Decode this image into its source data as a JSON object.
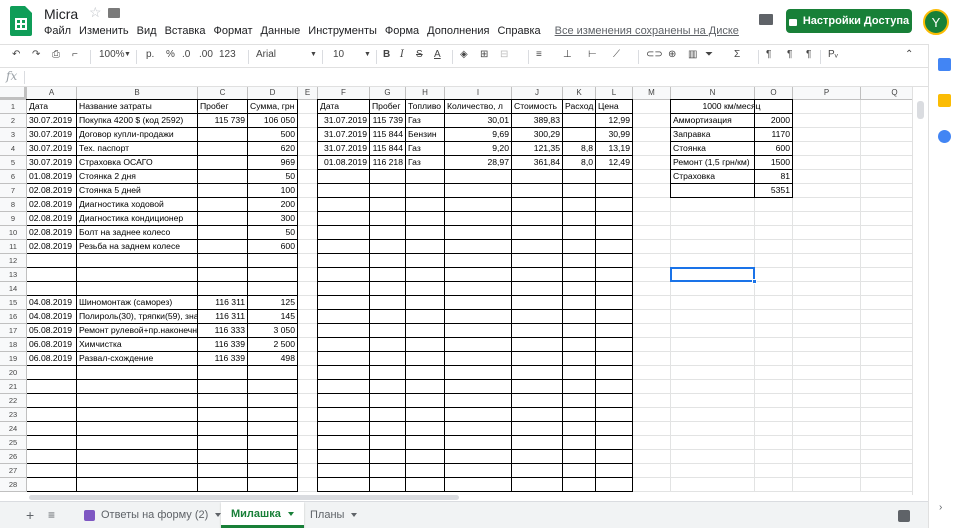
{
  "doc": {
    "title": "Micra",
    "star_icon": "star-icon",
    "folder_icon": "folder-icon"
  },
  "menu": [
    "Файл",
    "Изменить",
    "Вид",
    "Вставка",
    "Формат",
    "Данные",
    "Инструменты",
    "Форма",
    "Дополнения",
    "Справка"
  ],
  "saved_status": "Все изменения сохранены на Диске",
  "share_label": "Настройки Доступа",
  "avatar_letter": "Y",
  "toolbar": {
    "zoom": "100%",
    "currency": "р.",
    "percent": "%",
    "dec_dec": ".0",
    "inc_dec": ".00",
    "format_more": "123",
    "font": "Arial",
    "font_size": "10"
  },
  "columns": [
    {
      "name": "A",
      "w": 50
    },
    {
      "name": "B",
      "w": 121
    },
    {
      "name": "C",
      "w": 50
    },
    {
      "name": "D",
      "w": 50
    },
    {
      "name": "E",
      "w": 20
    },
    {
      "name": "F",
      "w": 52
    },
    {
      "name": "G",
      "w": 36
    },
    {
      "name": "H",
      "w": 39
    },
    {
      "name": "I",
      "w": 67
    },
    {
      "name": "J",
      "w": 51
    },
    {
      "name": "K",
      "w": 33
    },
    {
      "name": "L",
      "w": 37
    },
    {
      "name": "M",
      "w": 38
    },
    {
      "name": "N",
      "w": 84
    },
    {
      "name": "O",
      "w": 38
    },
    {
      "name": "P",
      "w": 68
    },
    {
      "name": "Q",
      "w": 68
    }
  ],
  "row_count": 28,
  "cells": [
    {
      "r": 1,
      "c": "A",
      "v": "Дата"
    },
    {
      "r": 1,
      "c": "B",
      "v": "Название затраты"
    },
    {
      "r": 1,
      "c": "C",
      "v": "Пробег"
    },
    {
      "r": 1,
      "c": "D",
      "v": "Сумма, грн"
    },
    {
      "r": 2,
      "c": "A",
      "v": "30.07.2019"
    },
    {
      "r": 2,
      "c": "B",
      "v": "Покупка 4200 $ (код 2592)"
    },
    {
      "r": 2,
      "c": "C",
      "v": "115 739",
      "a": "r"
    },
    {
      "r": 2,
      "c": "D",
      "v": "106 050",
      "a": "r"
    },
    {
      "r": 3,
      "c": "A",
      "v": "30.07.2019"
    },
    {
      "r": 3,
      "c": "B",
      "v": "Договор купли-продажи"
    },
    {
      "r": 3,
      "c": "D",
      "v": "500",
      "a": "r"
    },
    {
      "r": 4,
      "c": "A",
      "v": "30.07.2019"
    },
    {
      "r": 4,
      "c": "B",
      "v": "Тех. паспорт"
    },
    {
      "r": 4,
      "c": "D",
      "v": "620",
      "a": "r"
    },
    {
      "r": 5,
      "c": "A",
      "v": "30.07.2019"
    },
    {
      "r": 5,
      "c": "B",
      "v": "Страховка ОСАГО"
    },
    {
      "r": 5,
      "c": "D",
      "v": "969",
      "a": "r"
    },
    {
      "r": 6,
      "c": "A",
      "v": "01.08.2019"
    },
    {
      "r": 6,
      "c": "B",
      "v": "Стоянка 2 дня"
    },
    {
      "r": 6,
      "c": "D",
      "v": "50",
      "a": "r"
    },
    {
      "r": 7,
      "c": "A",
      "v": "02.08.2019"
    },
    {
      "r": 7,
      "c": "B",
      "v": "Стоянка 5 дней"
    },
    {
      "r": 7,
      "c": "D",
      "v": "100",
      "a": "r"
    },
    {
      "r": 8,
      "c": "A",
      "v": "02.08.2019"
    },
    {
      "r": 8,
      "c": "B",
      "v": "Диагностика ходовой"
    },
    {
      "r": 8,
      "c": "D",
      "v": "200",
      "a": "r"
    },
    {
      "r": 9,
      "c": "A",
      "v": "02.08.2019"
    },
    {
      "r": 9,
      "c": "B",
      "v": "Диагностика кондиционер"
    },
    {
      "r": 9,
      "c": "D",
      "v": "300",
      "a": "r"
    },
    {
      "r": 10,
      "c": "A",
      "v": "02.08.2019"
    },
    {
      "r": 10,
      "c": "B",
      "v": "Болт на заднее колесо"
    },
    {
      "r": 10,
      "c": "D",
      "v": "50",
      "a": "r"
    },
    {
      "r": 11,
      "c": "A",
      "v": "02.08.2019"
    },
    {
      "r": 11,
      "c": "B",
      "v": "Резьба на заднем колесе"
    },
    {
      "r": 11,
      "c": "D",
      "v": "600",
      "a": "r"
    },
    {
      "r": 15,
      "c": "A",
      "v": "04.08.2019"
    },
    {
      "r": 15,
      "c": "B",
      "v": "Шиномонтаж (саморез)"
    },
    {
      "r": 15,
      "c": "C",
      "v": "116 311",
      "a": "r"
    },
    {
      "r": 15,
      "c": "D",
      "v": "125",
      "a": "r"
    },
    {
      "r": 16,
      "c": "A",
      "v": "04.08.2019"
    },
    {
      "r": 16,
      "c": "B",
      "v": "Полироль(30), тряпки(59), зна"
    },
    {
      "r": 16,
      "c": "C",
      "v": "116 311",
      "a": "r"
    },
    {
      "r": 16,
      "c": "D",
      "v": "145",
      "a": "r"
    },
    {
      "r": 17,
      "c": "A",
      "v": "05.08.2019"
    },
    {
      "r": 17,
      "c": "B",
      "v": "Ремонт рулевой+пр.наконечн"
    },
    {
      "r": 17,
      "c": "C",
      "v": "116 333",
      "a": "r"
    },
    {
      "r": 17,
      "c": "D",
      "v": "3 050",
      "a": "r"
    },
    {
      "r": 18,
      "c": "A",
      "v": "06.08.2019"
    },
    {
      "r": 18,
      "c": "B",
      "v": "Химчистка"
    },
    {
      "r": 18,
      "c": "C",
      "v": "116 339",
      "a": "r"
    },
    {
      "r": 18,
      "c": "D",
      "v": "2 500",
      "a": "r"
    },
    {
      "r": 19,
      "c": "A",
      "v": "06.08.2019"
    },
    {
      "r": 19,
      "c": "B",
      "v": "Развал-схождение"
    },
    {
      "r": 19,
      "c": "C",
      "v": "116 339",
      "a": "r"
    },
    {
      "r": 19,
      "c": "D",
      "v": "498",
      "a": "r"
    },
    {
      "r": 1,
      "c": "F",
      "v": "Дата"
    },
    {
      "r": 1,
      "c": "G",
      "v": "Пробег"
    },
    {
      "r": 1,
      "c": "H",
      "v": "Топливо"
    },
    {
      "r": 1,
      "c": "I",
      "v": "Количество, л"
    },
    {
      "r": 1,
      "c": "J",
      "v": "Стоимость"
    },
    {
      "r": 1,
      "c": "K",
      "v": "Расход"
    },
    {
      "r": 1,
      "c": "L",
      "v": "Цена"
    },
    {
      "r": 2,
      "c": "F",
      "v": "31.07.2019",
      "a": "r"
    },
    {
      "r": 2,
      "c": "G",
      "v": "115 739",
      "a": "r"
    },
    {
      "r": 2,
      "c": "H",
      "v": "Газ"
    },
    {
      "r": 2,
      "c": "I",
      "v": "30,01",
      "a": "r"
    },
    {
      "r": 2,
      "c": "J",
      "v": "389,83",
      "a": "r"
    },
    {
      "r": 2,
      "c": "L",
      "v": "12,99",
      "a": "r"
    },
    {
      "r": 3,
      "c": "F",
      "v": "31.07.2019",
      "a": "r"
    },
    {
      "r": 3,
      "c": "G",
      "v": "115 844",
      "a": "r"
    },
    {
      "r": 3,
      "c": "H",
      "v": "Бензин"
    },
    {
      "r": 3,
      "c": "I",
      "v": "9,69",
      "a": "r"
    },
    {
      "r": 3,
      "c": "J",
      "v": "300,29",
      "a": "r"
    },
    {
      "r": 3,
      "c": "L",
      "v": "30,99",
      "a": "r"
    },
    {
      "r": 4,
      "c": "F",
      "v": "31.07.2019",
      "a": "r"
    },
    {
      "r": 4,
      "c": "G",
      "v": "115 844",
      "a": "r"
    },
    {
      "r": 4,
      "c": "H",
      "v": "Газ"
    },
    {
      "r": 4,
      "c": "I",
      "v": "9,20",
      "a": "r"
    },
    {
      "r": 4,
      "c": "J",
      "v": "121,35",
      "a": "r"
    },
    {
      "r": 4,
      "c": "K",
      "v": "8,8",
      "a": "r"
    },
    {
      "r": 4,
      "c": "L",
      "v": "13,19",
      "a": "r"
    },
    {
      "r": 5,
      "c": "F",
      "v": "01.08.2019",
      "a": "r"
    },
    {
      "r": 5,
      "c": "G",
      "v": "116 218",
      "a": "r"
    },
    {
      "r": 5,
      "c": "H",
      "v": "Газ"
    },
    {
      "r": 5,
      "c": "I",
      "v": "28,97",
      "a": "r"
    },
    {
      "r": 5,
      "c": "J",
      "v": "361,84",
      "a": "r"
    },
    {
      "r": 5,
      "c": "K",
      "v": "8,0",
      "a": "r"
    },
    {
      "r": 5,
      "c": "L",
      "v": "12,49",
      "a": "r"
    },
    {
      "r": 1,
      "c": "N",
      "v": "1000 км/месяц",
      "span": 2,
      "a": "c"
    },
    {
      "r": 2,
      "c": "N",
      "v": "Аммортизация"
    },
    {
      "r": 2,
      "c": "O",
      "v": "2000",
      "a": "r"
    },
    {
      "r": 3,
      "c": "N",
      "v": "Заправка"
    },
    {
      "r": 3,
      "c": "O",
      "v": "1170",
      "a": "r"
    },
    {
      "r": 4,
      "c": "N",
      "v": "Стоянка"
    },
    {
      "r": 4,
      "c": "O",
      "v": "600",
      "a": "r"
    },
    {
      "r": 5,
      "c": "N",
      "v": "Ремонт (1,5 грн/км)"
    },
    {
      "r": 5,
      "c": "O",
      "v": "1500",
      "a": "r"
    },
    {
      "r": 6,
      "c": "N",
      "v": "Страховка"
    },
    {
      "r": 6,
      "c": "O",
      "v": "81",
      "a": "r"
    },
    {
      "r": 7,
      "c": "O",
      "v": "5351",
      "a": "r"
    }
  ],
  "tabs": [
    {
      "label": "Ответы на форму (2)",
      "active": false
    },
    {
      "label": "Милашка",
      "active": true
    },
    {
      "label": "Планы",
      "active": false
    }
  ],
  "colors": {
    "accent": "#188038",
    "selection": "#1a73e8"
  }
}
